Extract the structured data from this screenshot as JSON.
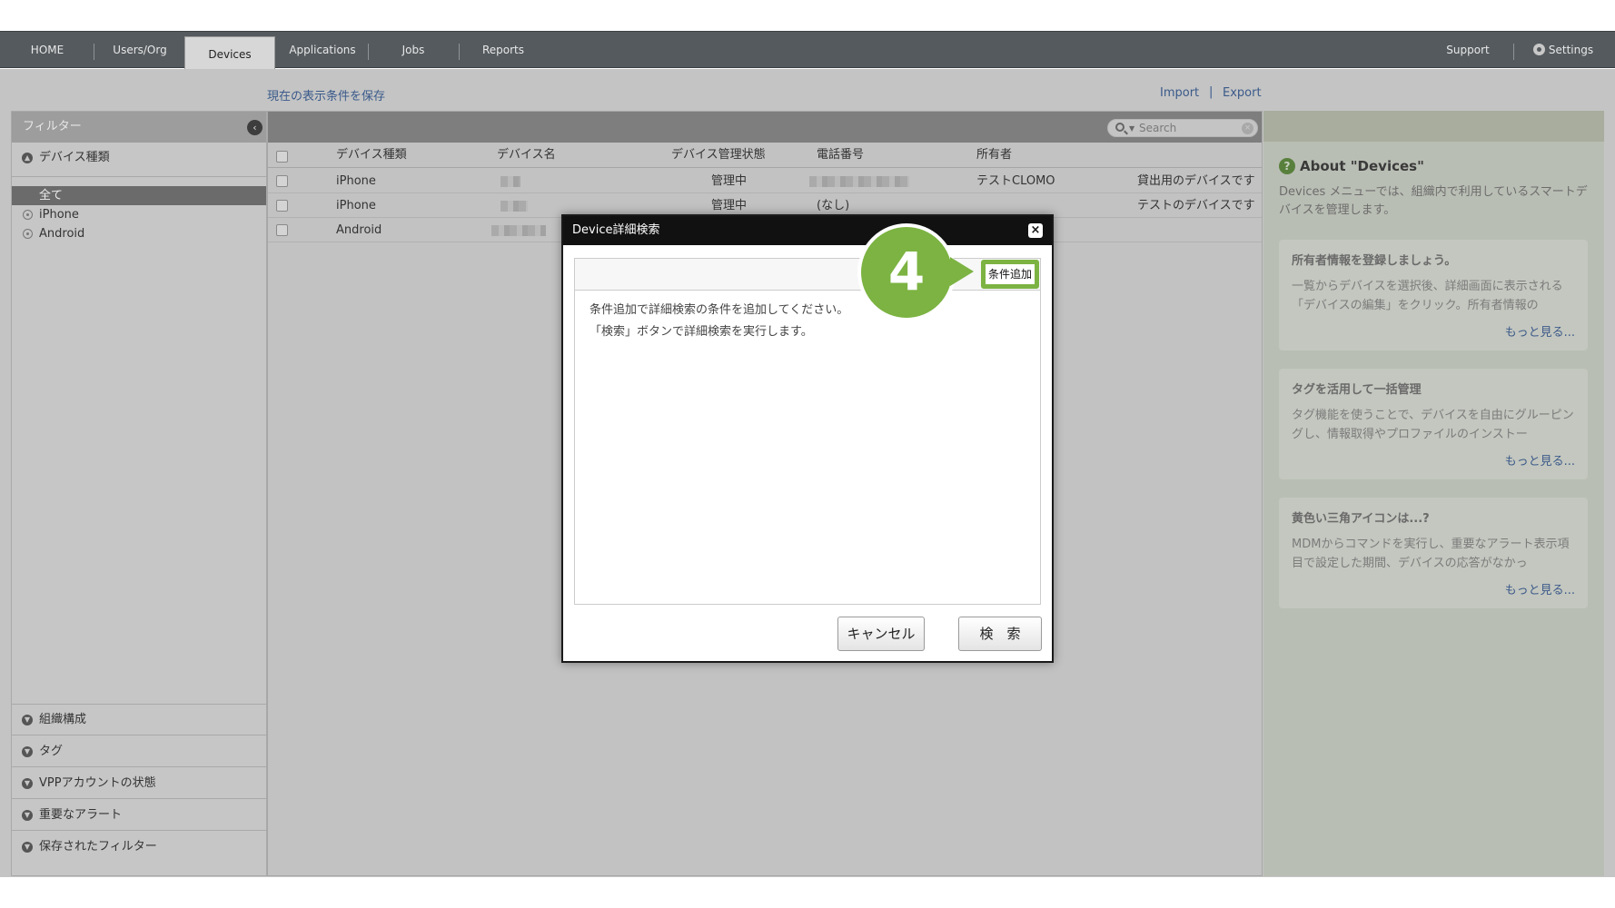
{
  "nav": {
    "tabs": [
      {
        "label": "HOME"
      },
      {
        "label": "Users/Org"
      },
      {
        "label": "Devices"
      },
      {
        "label": "Applications"
      },
      {
        "label": "Jobs"
      },
      {
        "label": "Reports"
      }
    ],
    "support": "Support",
    "settings": "Settings",
    "active_tab": "Devices"
  },
  "page": {
    "save_view": "現在の表示条件を保存",
    "import": "Import",
    "separator": "|",
    "export": "Export"
  },
  "sidebar": {
    "header": "フィルター",
    "device_type_section": "デバイス種類",
    "items": [
      "全て",
      "iPhone",
      "Android"
    ],
    "bottom_sections": [
      "組織構成",
      "タグ",
      "VPPアカウントの状態",
      "重要なアラート",
      "保存されたフィルター"
    ]
  },
  "table": {
    "search_placeholder": "Search",
    "columns": [
      "デバイス種類",
      "デバイス名",
      "デバイス管理状態",
      "電話番号",
      "所有者"
    ],
    "rows": [
      {
        "type": "iPhone",
        "status": "管理中",
        "phone": "",
        "owner": "テストCLOMO",
        "note": "貸出用のデバイスです"
      },
      {
        "type": "iPhone",
        "status": "管理中",
        "phone": "(なし)",
        "owner": "",
        "note": "テストのデバイスです"
      },
      {
        "type": "Android",
        "status": "",
        "phone": "",
        "owner": "",
        "note": ""
      }
    ]
  },
  "info": {
    "title": "About \"Devices\"",
    "description": "Devices メニューでは、組織内で利用しているスマートデバイスを管理します。",
    "cards": [
      {
        "title": "所有者情報を登録しましょう。",
        "text": "一覧からデバイスを選択後、詳細画面に表示される「デバイスの編集」をクリック。所有者情報の",
        "more": "もっと見る..."
      },
      {
        "title": "タグを活用して一括管理",
        "text": "タグ機能を使うことで、デバイスを自由にグルーピングし、情報取得やプロファイルのインストー",
        "more": "もっと見る..."
      },
      {
        "title": "黄色い三角アイコンは...?",
        "text": "MDMからコマンドを実行し、重要なアラート表示項目で設定した期間、デバイスの応答がなかっ",
        "more": "もっと見る..."
      }
    ]
  },
  "modal": {
    "title": "Device詳細検索",
    "close": "×",
    "add_condition": "条件追加",
    "instructions_1": "条件追加で詳細検索の条件を追加してください。",
    "instructions_2": "「検索」ボタンで詳細検索を実行します。",
    "cancel": "キャンセル",
    "search": "検　索"
  },
  "step": "4",
  "colors": {
    "accent_green": "#7cb342",
    "nav_bg": "#555a5e",
    "link_blue": "#3a5a8a"
  }
}
